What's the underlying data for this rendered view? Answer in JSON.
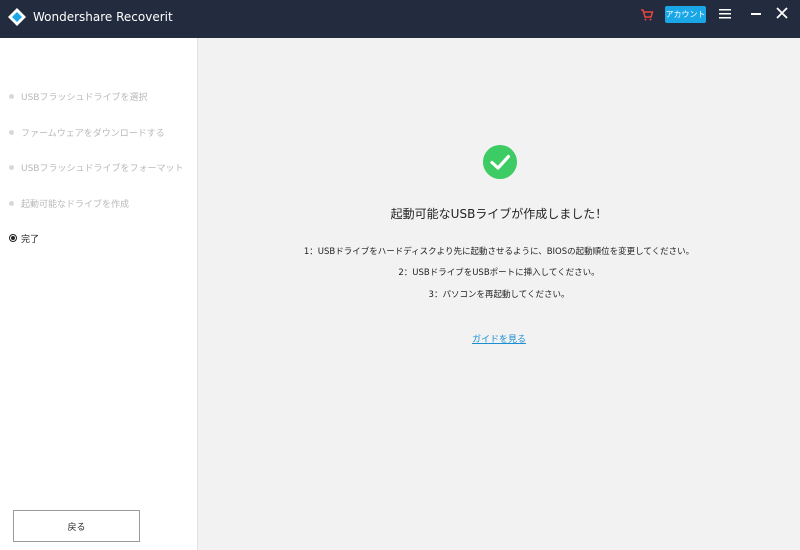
{
  "app": {
    "title": "Wondershare Recoverit"
  },
  "header": {
    "account_label": "アカウント"
  },
  "sidebar": {
    "steps": [
      {
        "label": "USBフラッシュドライブを選択"
      },
      {
        "label": "ファームウェアをダウンロードする"
      },
      {
        "label": "USBフラッシュドライブをフォーマット"
      },
      {
        "label": "起動可能なドライブを作成"
      },
      {
        "label": "完了"
      }
    ],
    "back_label": "戻る"
  },
  "main": {
    "success_title": "起動可能なUSBライブが作成しました！",
    "instructions": [
      "1：USBドライブをハードディスクより先に起動させるように、BIOSの起動順位を変更してください。",
      "2：USBドライブをUSBポートに挿入してください。",
      "3：パソコンを再起動してください。"
    ],
    "guide_link": "ガイドを見る"
  },
  "colors": {
    "titlebar": "#232b3e",
    "accent": "#1aa7e8",
    "success": "#3ccc63",
    "link": "#1a8fd2"
  }
}
